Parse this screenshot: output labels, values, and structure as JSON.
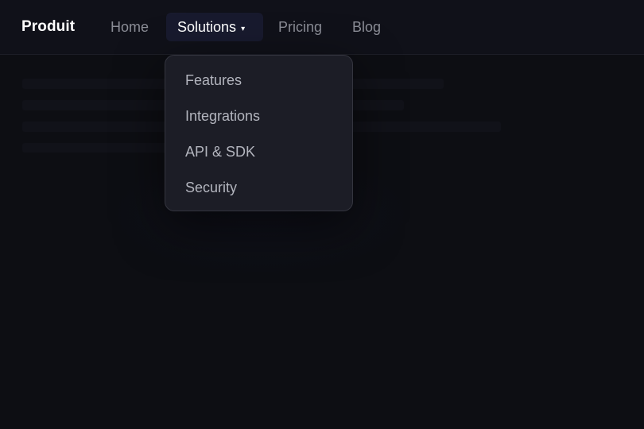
{
  "nav": {
    "brand": "Produit",
    "links": {
      "home": "Home",
      "solutions": "Solutions",
      "pricing": "Pricing",
      "blog": "Blog"
    },
    "solutions_caret": "▾"
  },
  "dropdown": {
    "items": [
      "Features",
      "Integrations",
      "API & SDK",
      "Security"
    ]
  },
  "colors": {
    "background": "#0d0e13",
    "topbar": "#101119",
    "active_tab": "#181a2e",
    "dropdown_bg": "#1c1d26",
    "text_active": "#ffffff",
    "text_muted": "#8b8d96"
  }
}
